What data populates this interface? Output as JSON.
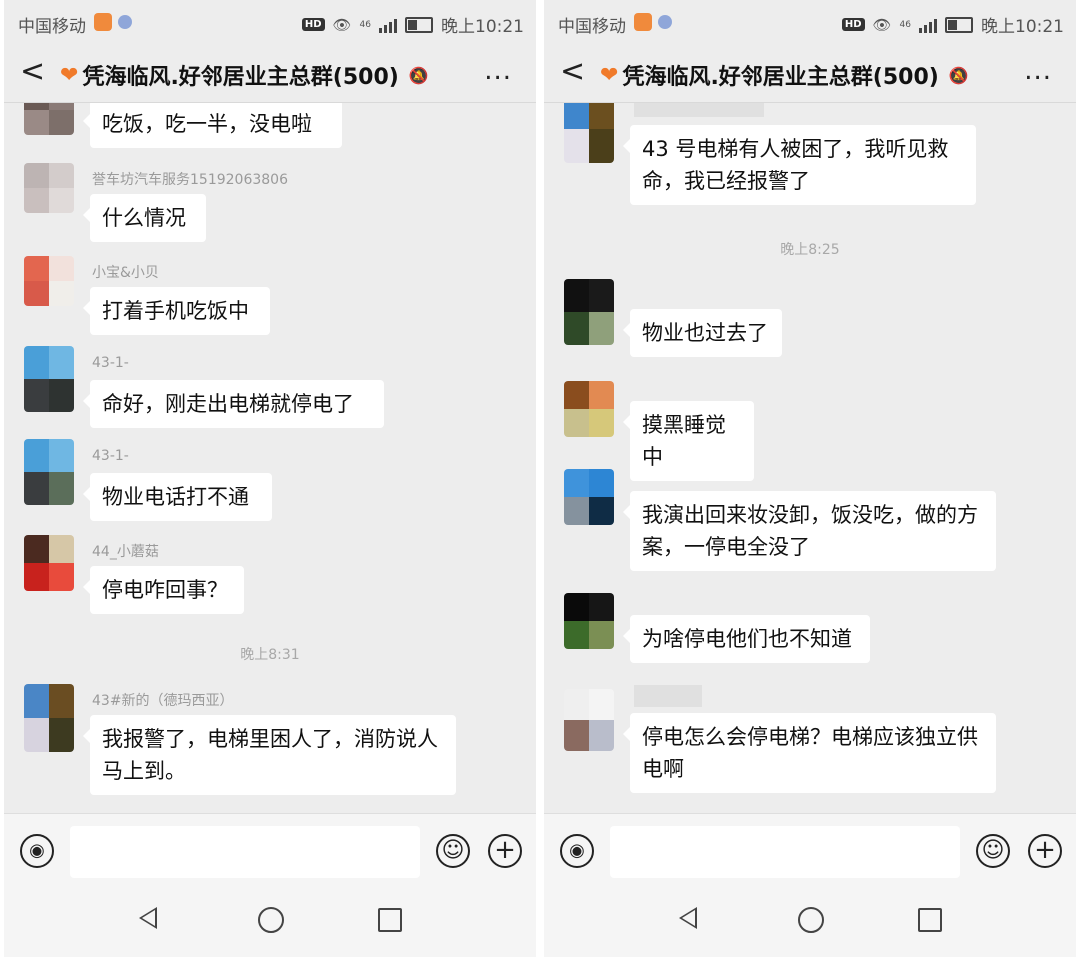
{
  "status": {
    "carrier": "中国移动",
    "network": "46",
    "time": "晚上10:21"
  },
  "header": {
    "back": "<",
    "title": "凭海临风.好邻居业主总群(500)",
    "more": "..."
  },
  "left": {
    "messages": [
      {
        "name": "",
        "text": "吃饭，吃一半，没电啦"
      },
      {
        "name": "誉车坊汽车服务15192063806",
        "text": "什么情况"
      },
      {
        "name": "小宝&小贝",
        "text": "打着手机吃饭中"
      },
      {
        "name": "43-1-",
        "text": "命好，刚走出电梯就停电了"
      },
      {
        "name": "43-1-",
        "text": "物业电话打不通"
      },
      {
        "name": "44_小蘑菇",
        "text": "停电咋回事？"
      },
      {
        "name": "43#新的（德玛西亚）",
        "text": "我报警了，电梯里困人了，消防说人马上到。"
      }
    ],
    "timestamp": "晚上8:31"
  },
  "right": {
    "messages": [
      {
        "name": "",
        "text": "43 号电梯有人被困了，我听见救命，我已经报警了"
      },
      {
        "name": "",
        "text": "物业也过去了"
      },
      {
        "name": "",
        "text": "摸黑睡觉中"
      },
      {
        "name": "",
        "text": "我演出回来妆没卸，饭没吃，做的方案，一停电全没了"
      },
      {
        "name": "",
        "text": "为啥停电他们也不知道"
      },
      {
        "name": "",
        "text": "停电怎么会停电梯？电梯应该独立供电啊"
      }
    ],
    "timestamp": "晚上8:25"
  },
  "icons": {
    "voice": "voice-icon",
    "emoji": "emoji-icon",
    "plus": "plus-icon",
    "nav_back": "nav-back-icon",
    "nav_home": "nav-home-icon",
    "nav_recent": "nav-recent-icon"
  },
  "colors": {
    "bg": "#ededed",
    "bubble": "#ffffff",
    "heart": "#f07a2a"
  }
}
